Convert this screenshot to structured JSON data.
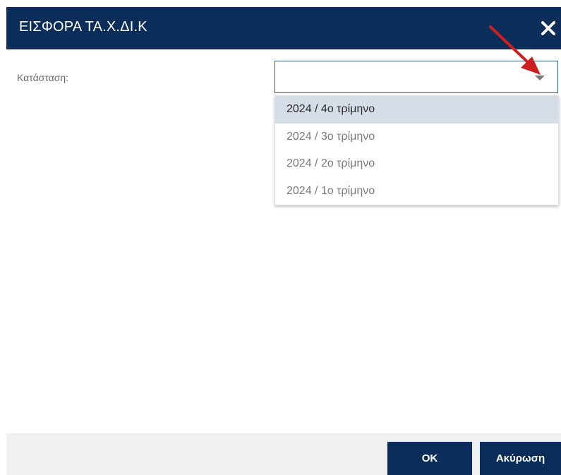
{
  "dialog": {
    "title": "ΕΙΣΦΟΡΑ ΤΑ.Χ.ΔΙ.Κ",
    "close_icon": "close-icon",
    "header_color": "#0b2d5a"
  },
  "form": {
    "status_label": "Κατάσταση:",
    "status_value": ""
  },
  "dropdown": {
    "options": [
      "2024 / 4ο τρίμηνο",
      "2024 / 3ο τρίμηνο",
      "2024 / 2ο τρίμηνο",
      "2024 / 1ο τρίμηνο"
    ],
    "highlighted_index": 0
  },
  "footer": {
    "ok_label": "OK",
    "cancel_label": "Ακύρωση"
  },
  "annotation": {
    "arrow_color": "#cc1f1f"
  }
}
